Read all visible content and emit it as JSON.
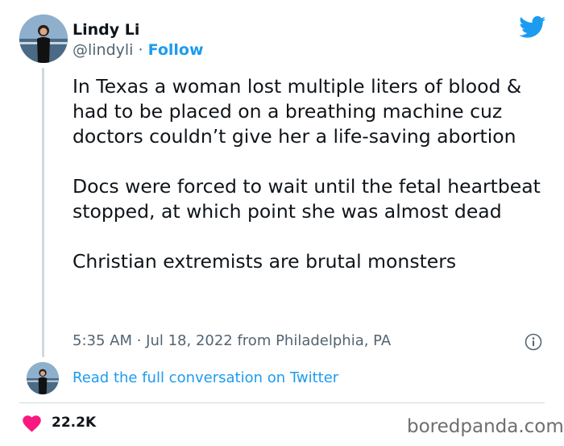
{
  "author": {
    "name": "Lindy Li",
    "handle": "@lindyli",
    "separator": "·",
    "follow_label": "Follow"
  },
  "tweet": {
    "paragraphs": [
      "In Texas a woman lost multiple liters of blood & had to be placed on a breathing machine cuz doctors couldn’t give her a life-saving abortion",
      "Docs were forced to wait until the fetal heartbeat stopped, at which point she was almost dead",
      "Christian extremists are brutal monsters"
    ],
    "timestamp": "5:35 AM · Jul 18, 2022 from Philadelphia, PA"
  },
  "conversation_link": "Read the full conversation on Twitter",
  "likes": "22.2K",
  "watermark": "boredpanda.com",
  "icons": {
    "brand": "twitter-bird-icon",
    "info": "info-icon",
    "like": "heart-icon"
  },
  "colors": {
    "accent": "#1d9bf0",
    "heart": "#f91880",
    "text": "#0f1419",
    "muted": "#536471",
    "divider": "#cfd9de"
  }
}
